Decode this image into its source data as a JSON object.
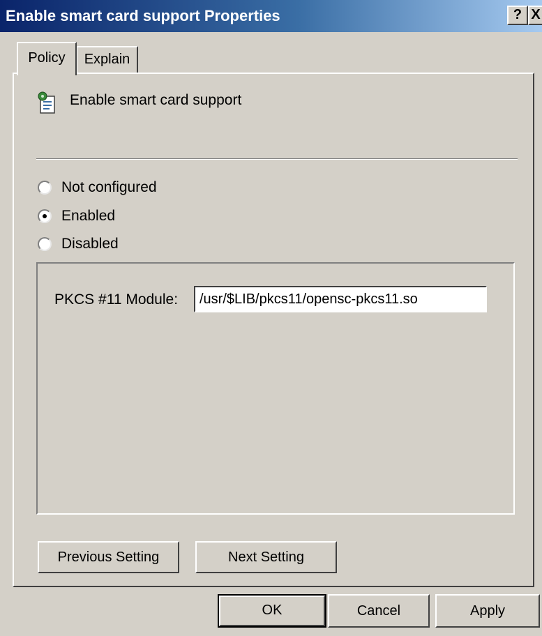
{
  "window": {
    "title": "Enable smart card support Properties",
    "help_button": "?",
    "close_button": "X"
  },
  "tabs": [
    {
      "label": "Policy",
      "active": true
    },
    {
      "label": "Explain",
      "active": false
    }
  ],
  "policy": {
    "icon": "policy-settings-icon",
    "title": "Enable smart card support",
    "options": [
      {
        "label": "Not configured",
        "selected": false
      },
      {
        "label": "Enabled",
        "selected": true
      },
      {
        "label": "Disabled",
        "selected": false
      }
    ],
    "pkcs_label": "PKCS #11 Module:",
    "pkcs_value": "/usr/$LIB/pkcs11/opensc-pkcs11.so"
  },
  "buttons": {
    "previous": "Previous Setting",
    "next": "Next Setting",
    "ok": "OK",
    "cancel": "Cancel",
    "apply": "Apply"
  },
  "colors": {
    "title_bar_start": "#0a246a",
    "title_bar_end": "#a6caf0",
    "dialog_face": "#d4d0c8"
  }
}
